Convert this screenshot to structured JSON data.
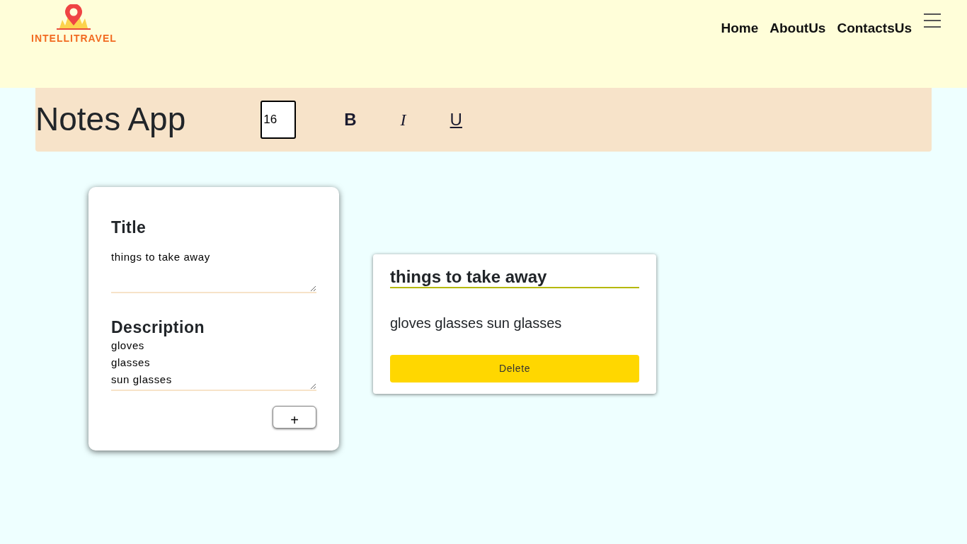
{
  "brand": {
    "name": "INTELLITRAVEL"
  },
  "nav": {
    "links": [
      {
        "label": "Home"
      },
      {
        "label": "AboutUs"
      },
      {
        "label": "ContactsUs"
      }
    ]
  },
  "toolbar": {
    "title": "Notes App",
    "font_size": "16",
    "format_buttons": [
      {
        "label": "B",
        "kind": "bold"
      },
      {
        "label": "I",
        "kind": "italic"
      },
      {
        "label": "U",
        "kind": "underline"
      }
    ]
  },
  "form": {
    "title_label": "Title",
    "title_value": "things to take away",
    "description_label": "Description",
    "description_value": "gloves\nglasses\nsun glasses",
    "add_button": "+"
  },
  "notes": [
    {
      "title": "things to take away",
      "body": "gloves glasses sun glasses",
      "delete_button": "Delete"
    }
  ]
}
